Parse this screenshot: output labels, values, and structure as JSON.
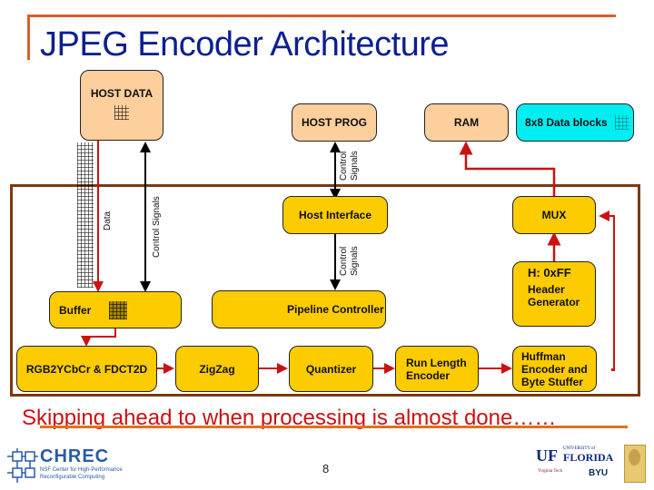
{
  "slide": {
    "title": "JPEG Encoder Architecture",
    "caption": "Skipping ahead to when processing is almost done……",
    "page_number": "8"
  },
  "diagram": {
    "external_blocks": {
      "host_data": "HOST DATA",
      "host_prog": "HOST PROG",
      "ram": "RAM",
      "data_blocks": "8x8 Data blocks"
    },
    "internal_blocks": {
      "host_interface": "Host Interface",
      "mux": "MUX",
      "header_generator_line1": "H: 0xFF",
      "header_generator_line2": "Header",
      "header_generator_line3": "Generator",
      "buffer": "Buffer",
      "pipeline_controller": "Pipeline Controller",
      "rgb2ycbcr": "RGB2YCbCr & FDCT2D",
      "zigzag": "ZigZag",
      "quantizer": "Quantizer",
      "run_length_line1": "Run Length",
      "run_length_line2": "Encoder",
      "huffman_line1": "Huffman",
      "huffman_line2": "Encoder and",
      "huffman_line3": "Byte Stuffer"
    },
    "signal_labels": {
      "data": "Data",
      "control_signals": "Control Signals",
      "control": "Control",
      "signals": "Signals"
    },
    "colors": {
      "external_block": "#fccf9c",
      "internal_block": "#fccc00",
      "data_block": "#00eef2",
      "data_path": "#cc1111",
      "control_path": "#000000",
      "frame": "#7a3a12",
      "title": "#0d1f8f",
      "accent_rule": "#d9602a"
    }
  },
  "footer": {
    "left_logo": {
      "name": "CHREC",
      "subtitle_line1": "NSF Center for High-Performance",
      "subtitle_line2": "Reconfigurable Computing"
    },
    "right_logos": {
      "uf": "UF",
      "uf_university": "UNIVERSITY of",
      "uf_florida": "FLORIDA",
      "vt": "Virginia Tech",
      "byu": "BYU"
    }
  }
}
